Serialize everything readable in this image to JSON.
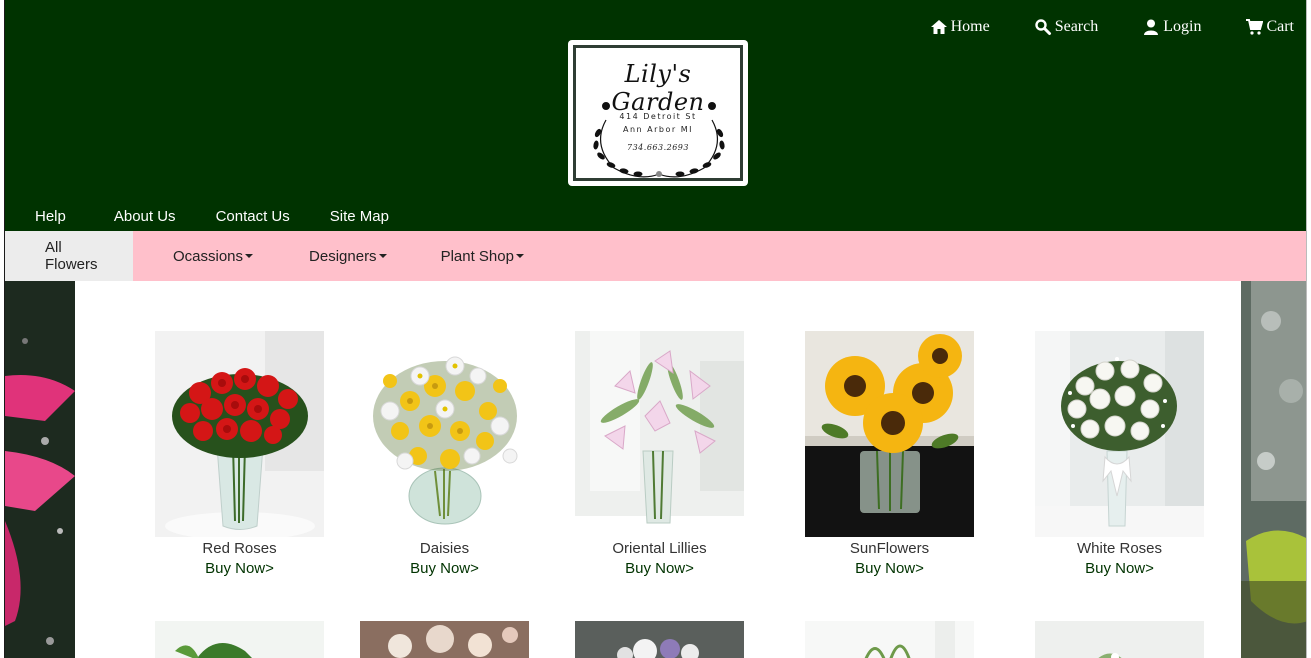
{
  "header": {
    "utility_links": [
      {
        "label": "Home",
        "icon": "home-icon"
      },
      {
        "label": "Search",
        "icon": "search-icon"
      },
      {
        "label": "Login",
        "icon": "user-icon"
      },
      {
        "label": "Cart",
        "icon": "cart-icon"
      }
    ],
    "logo": {
      "title": "Lily's Garden",
      "address_line1": "414 Detroit St",
      "address_line2": "Ann Arbor MI",
      "phone": "734.663.2693"
    },
    "main_nav": [
      "Help",
      "About Us",
      "Contact Us",
      "Site Map"
    ]
  },
  "category_nav": [
    {
      "label": "All Flowers",
      "active": true,
      "dropdown": false
    },
    {
      "label": "Ocassions",
      "active": false,
      "dropdown": true
    },
    {
      "label": "Designers",
      "active": false,
      "dropdown": true
    },
    {
      "label": "Plant Shop",
      "active": false,
      "dropdown": true
    }
  ],
  "products": [
    {
      "name": "Red Roses",
      "cta": "Buy Now>"
    },
    {
      "name": "Daisies",
      "cta": "Buy Now>"
    },
    {
      "name": "Oriental Lillies",
      "cta": "Buy Now>"
    },
    {
      "name": "SunFlowers",
      "cta": "Buy Now>"
    },
    {
      "name": "White Roses",
      "cta": "Buy Now>"
    }
  ],
  "colors": {
    "header_bg": "#003300",
    "category_nav_bg": "#ffc0cb",
    "active_tab_bg": "#ececec",
    "link_green": "#003300"
  }
}
